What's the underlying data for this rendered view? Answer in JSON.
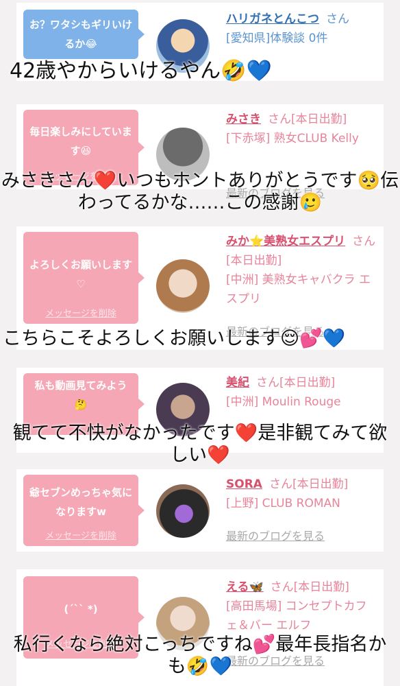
{
  "cards": [
    {
      "bubble": "お？ワタシもギリいけるか😂",
      "delete_label": "メッセージを削除",
      "name": "ハリガネとんこつ",
      "san": "さん",
      "status": "",
      "shop": "[愛知県]体験談 0件",
      "blog": ""
    },
    {
      "bubble": "毎日楽しみにしています😆",
      "delete_label": "メッセージを削除",
      "name": "みさき",
      "san": "さん",
      "status": "[本日出勤]",
      "shop": "[下赤塚] 熟女CLUB Kelly",
      "blog": "最新のブログを見る"
    },
    {
      "bubble": "よろしくお願いします♡",
      "delete_label": "メッセージを削除",
      "name": "みか⭐美熟女エスプリ",
      "san": "さん",
      "status": "[本日出勤]",
      "shop": "[中洲] 美熟女キャバクラ エスプリ",
      "blog": "最新のブログを見る"
    },
    {
      "bubble": "私も動画見てみよう🤔",
      "delete_label": "",
      "name": "美紀",
      "san": "さん",
      "status": "[本日出勤]",
      "shop": "[中洲] Moulin Rouge",
      "blog": ""
    },
    {
      "bubble": "爺セブンめっちゃ気になりますw",
      "delete_label": "メッセージを削除",
      "name": "SORA",
      "san": "さん",
      "status": "[本日出勤]",
      "shop": "[上野] CLUB ROMAN",
      "blog": "最新のブログを見る"
    },
    {
      "bubble": "(´`` *)",
      "delete_label": "メッセージを削除",
      "name": "える🦋",
      "san": "さん",
      "status": "[本日出勤]",
      "shop": "[高田馬場] コンセプトカフェ＆バー エルフ",
      "blog": "最新のブログを見る"
    }
  ],
  "overlays": [
    "42歳やからいけるやん🤣💙",
    "みさきさん❤️いつもホントありがとうです🥺伝わってるかな……この感謝🥲",
    "こちらこそよろしくお願いします😌💕💙",
    "観てて不快がなかったです❤️是非観てみて欲しい❤️",
    "私行くなら絶対こっちですね💕最年長指名かも🤣💙"
  ],
  "colors": {
    "bubble_blue": "#7fb2e8",
    "bubble_pink": "#f5a7b5",
    "name_pink": "#d9506f",
    "name_blue": "#2f6fb4",
    "text_pink": "#e7849a"
  }
}
